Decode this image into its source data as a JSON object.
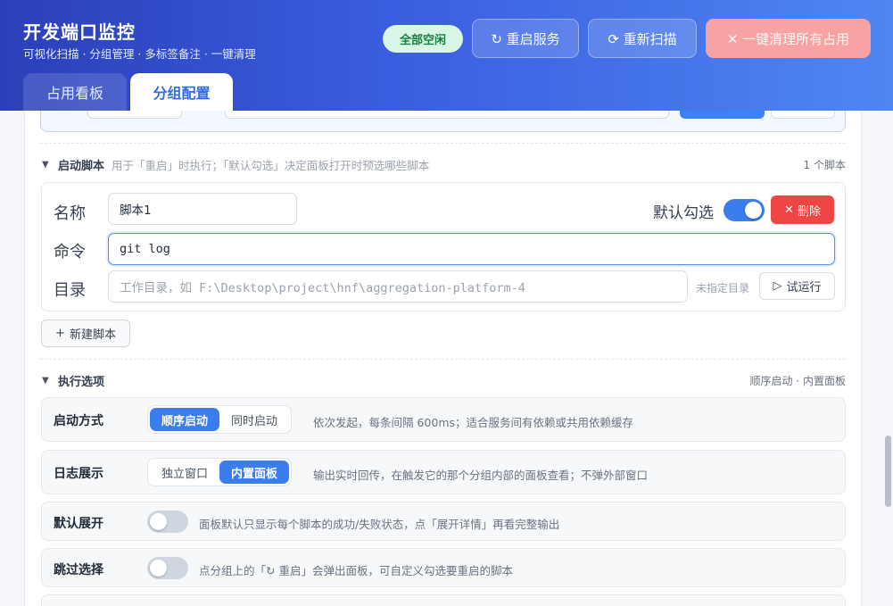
{
  "header": {
    "title": "开发端口监控",
    "subtitle": "可视化扫描 · 分组管理 · 多标签备注 · 一键清理",
    "status": "全部空闲",
    "restart_label": "↻ 重启服务",
    "rescan_label": "⟳ 重新扫描",
    "clear_label": "✕ 一键清理所有占用"
  },
  "tabs": [
    {
      "label": "占用看板"
    },
    {
      "label": "分组配置"
    }
  ],
  "startup": {
    "title": "启动脚本",
    "desc": "用于「重启」时执行；「默认勾选」决定面板打开时预选哪些脚本",
    "count": "1 个脚本",
    "script": {
      "name_label": "名称",
      "name_value": "脚本1",
      "default_label": "默认勾选",
      "default_on": true,
      "delete_label": "删除",
      "cmd_label": "命令",
      "cmd_value": "git log",
      "dir_label": "目录",
      "dir_placeholder": "工作目录，如 F:\\Desktop\\project\\hnf\\aggregation-platform-4",
      "dir_status": "未指定目录",
      "try_label": "试运行"
    },
    "new_script_label": "新建脚本"
  },
  "exec": {
    "title": "执行选项",
    "meta": "顺序启动 · 内置面板",
    "rows": [
      {
        "label": "启动方式",
        "options": [
          "顺序启动",
          "同时启动"
        ],
        "selected": 0,
        "desc": "依次发起，每条间隔 600ms；适合服务间有依赖或共用依赖缓存"
      },
      {
        "label": "日志展示",
        "options": [
          "独立窗口",
          "内置面板"
        ],
        "selected": 1,
        "desc": "输出实时回传，在触发它的那个分组内部的面板查看；不弹外部窗口"
      },
      {
        "label": "默认展开",
        "toggle_on": false,
        "desc": "面板默认只显示每个脚本的成功/失败状态，点「展开详情」再看完整输出"
      },
      {
        "label": "跳过选择",
        "toggle_on": false,
        "desc": "点分组上的「↻ 重启」会弹出面板，可自定义勾选要重启的脚本"
      }
    ]
  },
  "colors": {
    "accent": "#3b7ded",
    "danger": "#ef4444",
    "success_bg": "#d9f7e6",
    "success_text": "#15803d"
  }
}
